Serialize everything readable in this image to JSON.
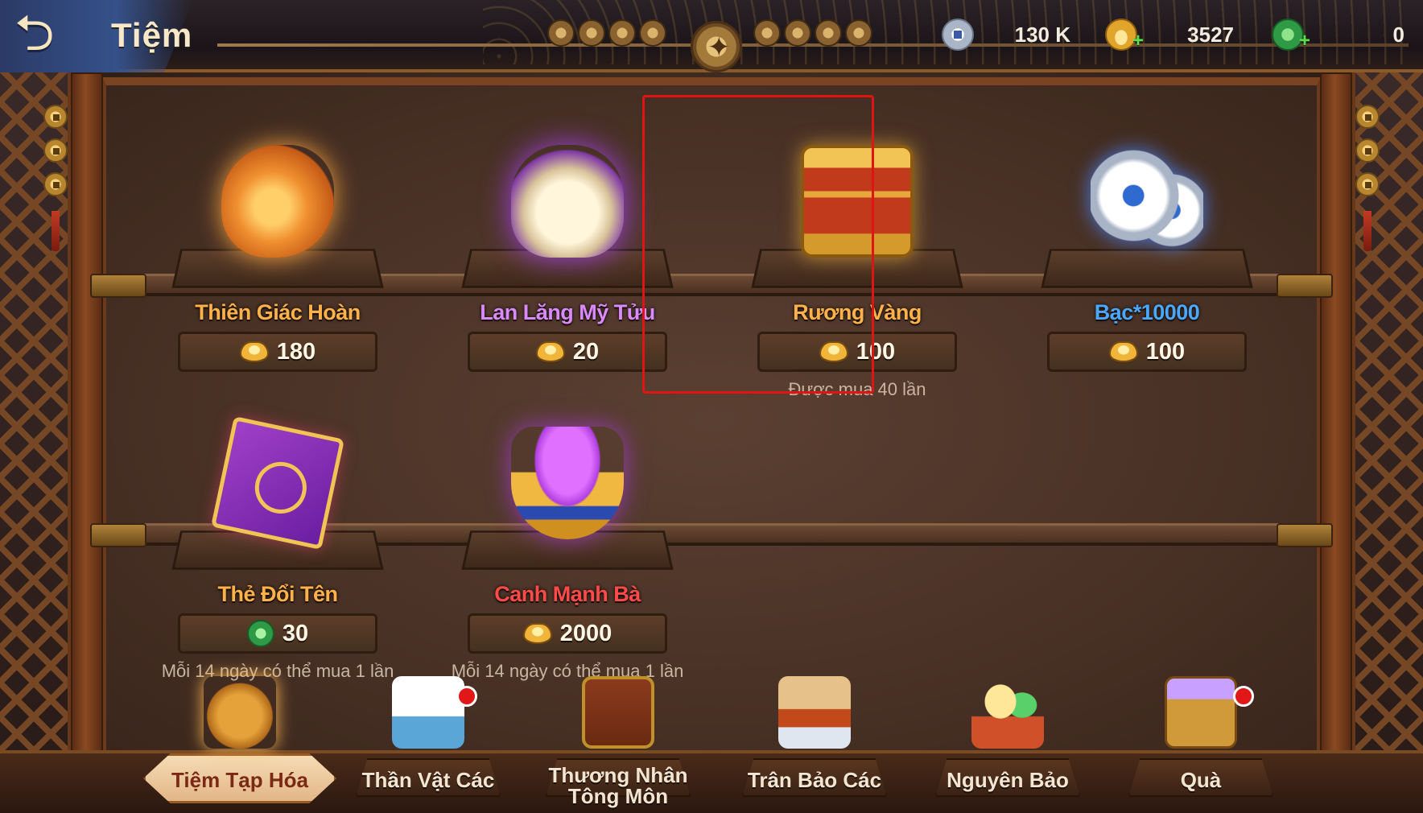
{
  "header": {
    "title": "Tiệm",
    "currencies": [
      {
        "icon": "silver-coin-icon",
        "value": "130 K"
      },
      {
        "icon": "gold-ingot-icon",
        "value": "3527"
      },
      {
        "icon": "jade-icon",
        "value": "0"
      }
    ]
  },
  "items": [
    {
      "name": "Thiên Giác Hoàn",
      "name_color": "#ffb24a",
      "price": "180",
      "currency": "gold-ingot-icon",
      "note": ""
    },
    {
      "name": "Lan Lăng Mỹ Tửu",
      "name_color": "#d98aff",
      "price": "20",
      "currency": "gold-ingot-icon",
      "note": ""
    },
    {
      "name": "Rương Vàng",
      "name_color": "#ffb24a",
      "price": "100",
      "currency": "gold-ingot-icon",
      "note": "Được mua 40 lần"
    },
    {
      "name": "Bạc*10000",
      "name_color": "#4aa8ff",
      "price": "100",
      "currency": "gold-ingot-icon",
      "note": ""
    },
    {
      "name": "Thẻ Đổi Tên",
      "name_color": "#ffb24a",
      "price": "30",
      "currency": "jade-icon",
      "note": "Mỗi 14 ngày có thể mua 1 lần"
    },
    {
      "name": "Canh Mạnh Bà",
      "name_color": "#ff4a4a",
      "price": "2000",
      "currency": "gold-ingot-icon",
      "note": "Mỗi 14 ngày có thể mua 1 lần"
    }
  ],
  "tabs": [
    {
      "label": "Tiệm Tạp Hóa",
      "active": true,
      "badge": false
    },
    {
      "label": "Thần Vật Các",
      "active": false,
      "badge": true
    },
    {
      "label": "Thương Nhân\nTông Môn",
      "active": false,
      "badge": false
    },
    {
      "label": "Trân Bảo Các",
      "active": false,
      "badge": false
    },
    {
      "label": "Nguyên Bảo",
      "active": false,
      "badge": false
    },
    {
      "label": "Quà",
      "active": false,
      "badge": true
    }
  ],
  "colors": {
    "highlight": "#e11414",
    "badge": "#e21818"
  }
}
